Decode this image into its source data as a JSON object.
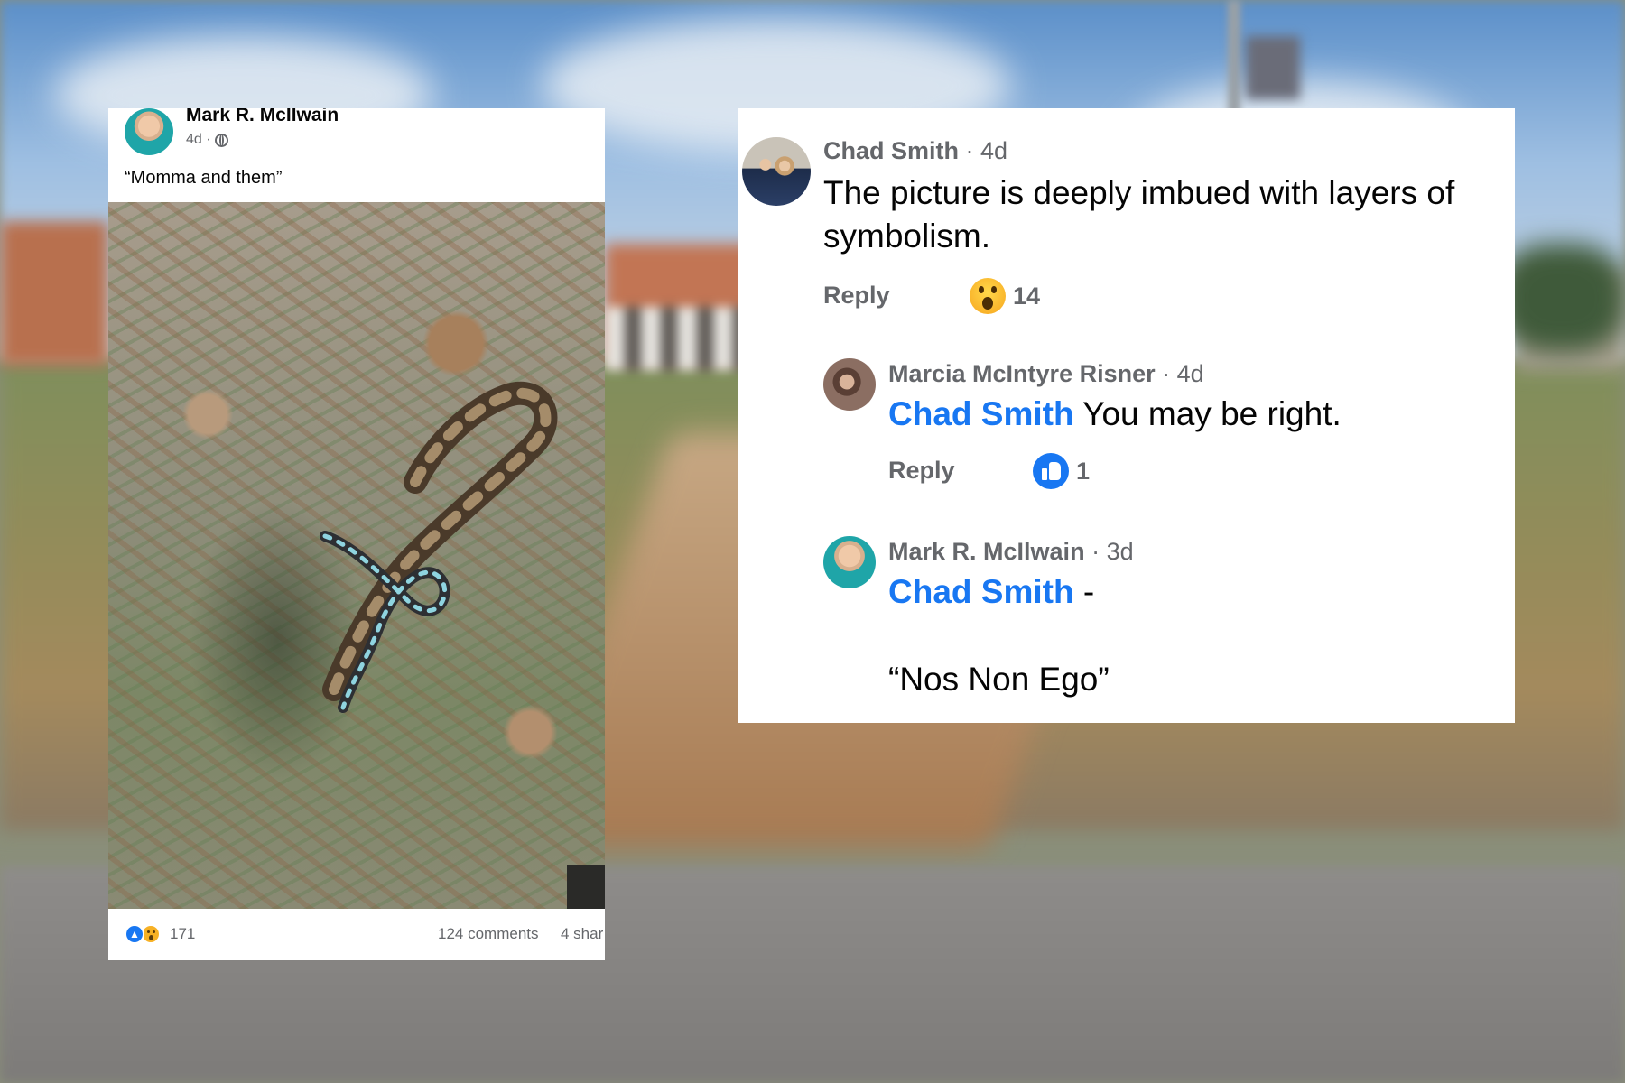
{
  "post": {
    "author": "Mark R. McIlwain",
    "time": "4d ·",
    "caption": "“Momma and them”",
    "reaction_count": "171",
    "comments": "124 comments",
    "shares": "4 shar"
  },
  "comments": [
    {
      "name": "Chad Smith",
      "time": "· 4d",
      "text": "The picture is deeply imbued with layers of symbolism.",
      "reply_label": "Reply",
      "reaction_icon": "wow-icon",
      "reaction_count": "14"
    },
    {
      "name": "Marcia McIntyre Risner",
      "time": "· 4d",
      "mention": "Chad Smith",
      "text": " You may be right.",
      "reply_label": "Reply",
      "reaction_icon": "like-icon",
      "reaction_count": "1"
    },
    {
      "name": "Mark R. McIlwain",
      "time": "· 3d",
      "mention": "Chad Smith",
      "text": " -",
      "text2": "“Nos Non Ego”"
    }
  ],
  "colors": {
    "facebook_blue": "#1877f2",
    "meta_gray": "#65676b",
    "text_black": "#050505"
  }
}
